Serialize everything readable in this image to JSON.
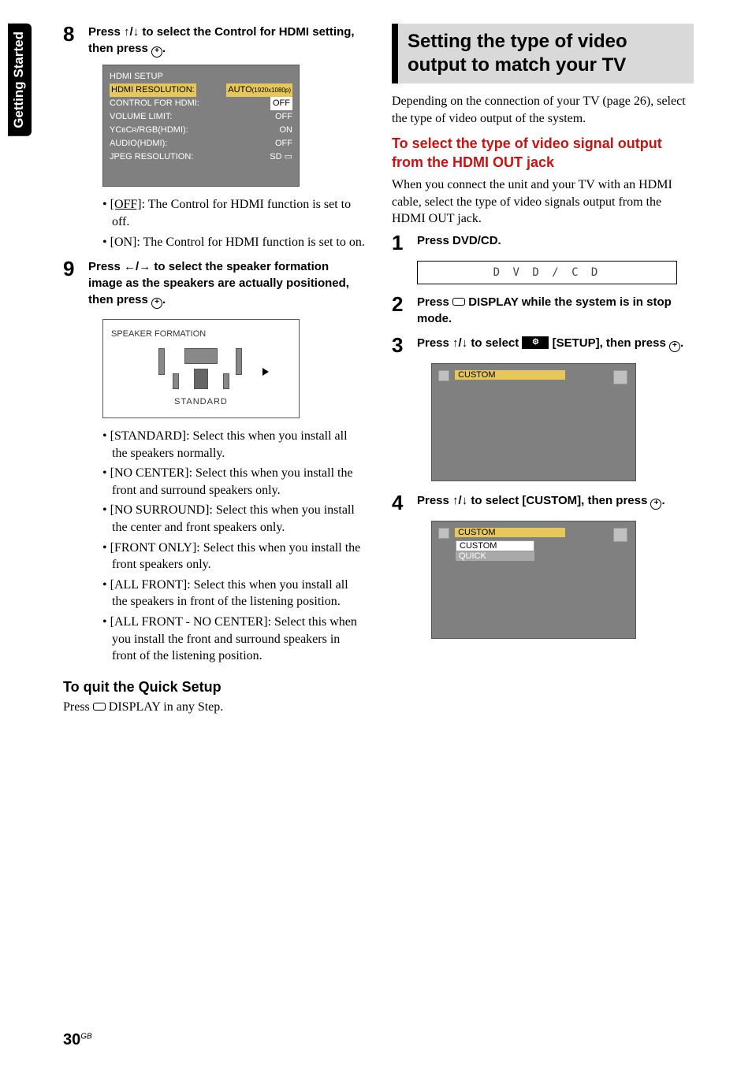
{
  "sidetab": "Getting Started",
  "left": {
    "step8": {
      "num": "8",
      "text_a": "Press ",
      "text_arrows": "↑/↓",
      "text_b": " to select the Control for HDMI setting, then press ",
      "text_c": "."
    },
    "osd": {
      "title": "HDMI SETUP",
      "r1l": "HDMI RESOLUTION:",
      "r1r_a": "AUTO",
      "r1r_b": "(1920x1080p)",
      "r2l": "CONTROL FOR HDMI:",
      "r2r": "OFF",
      "r3l": "VOLUME LIMIT:",
      "r3r": "OFF",
      "r4l_a": "YC",
      "r4l_b": "B",
      "r4l_c": "C",
      "r4l_d": "R",
      "r4l_e": "/RGB(HDMI):",
      "r4r": "ON",
      "r5l": "AUDIO(HDMI):",
      "r5r": "OFF",
      "r6l": "JPEG RESOLUTION:",
      "r6r": "SD ▭"
    },
    "bul1a": "[OFF]",
    "bul1b": ": The Control for HDMI function is set to off.",
    "bul2": "[ON]: The Control for HDMI function is set to on.",
    "step9": {
      "num": "9",
      "text_a": "Press ",
      "text_arrows": "←/→",
      "text_b": " to select the speaker formation image as the speakers are actually positioned, then press ",
      "text_c": "."
    },
    "spk_title": "SPEAKER FORMATION",
    "spk_mode": "STANDARD",
    "opts": {
      "a": "[STANDARD]: Select this when you install all the speakers normally.",
      "b": "[NO CENTER]: Select this when you install the front and surround speakers only.",
      "c": "[NO SURROUND]: Select this when you install the center and front speakers only.",
      "d": "[FRONT ONLY]: Select this when you install the front speakers only.",
      "e": "[ALL FRONT]: Select this when you install all the speakers in front of the listening position.",
      "f": "[ALL FRONT - NO CENTER]: Select this when you install the front and surround speakers in front of the listening position."
    },
    "quitHead": "To quit the Quick Setup",
    "quitBody_a": "Press ",
    "quitBody_b": " DISPLAY in any Step."
  },
  "right": {
    "heading": "Setting the type of video output to match your TV",
    "intro": "Depending on the connection of your TV (page 26), select the type of video output of the system.",
    "redhead": "To select the type of video signal output from the HDMI OUT jack",
    "intro2": "When you connect the unit and your TV with an HDMI cable, select the type of video signals output from the HDMI OUT jack.",
    "s1": {
      "num": "1",
      "text": "Press DVD/CD."
    },
    "lcd": "D V D / C D",
    "s2": {
      "num": "2",
      "text_a": "Press ",
      "text_b": " DISPLAY while the system is in stop mode."
    },
    "s3": {
      "num": "3",
      "text_a": "Press ",
      "arrows": "↑/↓",
      "text_b": " to select ",
      "label": " [SETUP], then press ",
      "text_c": "."
    },
    "osd3": {
      "item": "CUSTOM"
    },
    "s4": {
      "num": "4",
      "text_a": "Press ",
      "arrows": "↑/↓",
      "text_b": " to select [CUSTOM], then press ",
      "text_c": "."
    },
    "osd4": {
      "a": "CUSTOM",
      "b": "CUSTOM",
      "c": "QUICK"
    }
  },
  "pagenum": "30",
  "pagesuffix": "GB"
}
